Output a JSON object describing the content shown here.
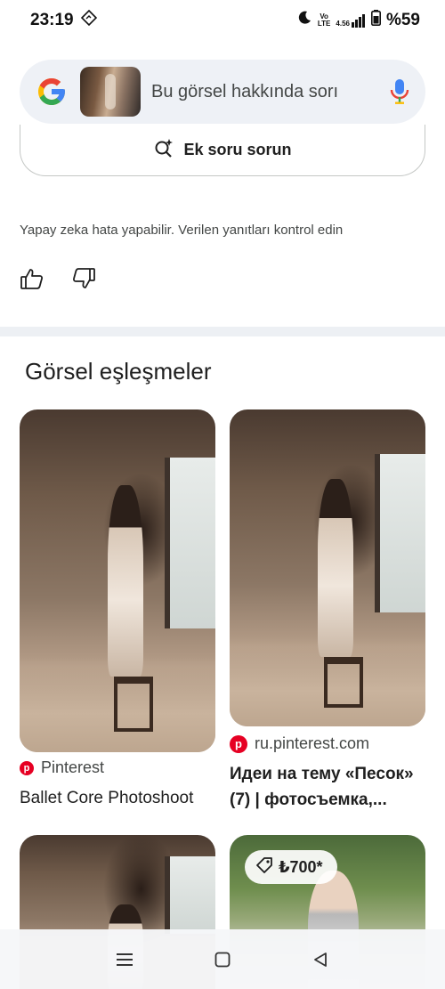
{
  "status_bar": {
    "time": "23:19",
    "network_top": "Vo",
    "network_bottom": "LTE",
    "signal_speed": "4.56",
    "battery": "%59"
  },
  "search": {
    "query_text": "Bu görsel hakkında sorı"
  },
  "ask_button": {
    "label": "Ek soru sorun"
  },
  "disclaimer": "Yapay zeka hata yapabilir. Verilen yanıtları kontrol edin",
  "visual_matches": {
    "title": "Görsel eşleşmeler",
    "cards": [
      {
        "source": "Pinterest",
        "title": "Ballet Core Photoshoot"
      },
      {
        "source": "ru.pinterest.com",
        "title_line1": "Идеи на тему «Песок»",
        "title_line2": "(7) | фотосъемка,..."
      },
      {
        "source": "",
        "title": ""
      },
      {
        "price": "₺700*"
      }
    ]
  },
  "icons": {
    "alarm": "alarm-icon",
    "dnd": "moon-icon",
    "signal": "signal-icon",
    "battery": "battery-icon",
    "google": "google-logo",
    "mic": "mic-icon",
    "sparkle": "sparkle-search-icon",
    "like": "thumbs-up-icon",
    "dislike": "thumbs-down-icon",
    "pinterest": "pinterest-icon",
    "tag": "price-tag-icon",
    "menu": "menu-icon",
    "home": "home-icon",
    "back": "back-icon"
  },
  "colors": {
    "accent_blue": "#4285f4",
    "google_red": "#ea4335",
    "google_yellow": "#fbbc05",
    "google_green": "#34a853",
    "pinterest_red": "#e60023",
    "search_bg": "#eef1f6"
  }
}
